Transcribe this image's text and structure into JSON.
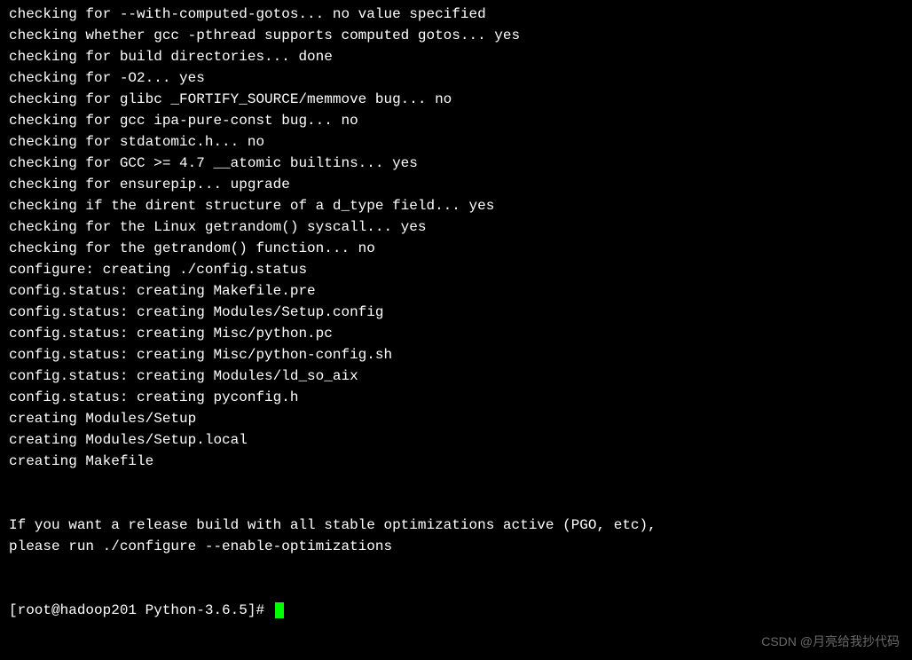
{
  "output_lines": [
    "checking for --with-computed-gotos... no value specified",
    "checking whether gcc -pthread supports computed gotos... yes",
    "checking for build directories... done",
    "checking for -O2... yes",
    "checking for glibc _FORTIFY_SOURCE/memmove bug... no",
    "checking for gcc ipa-pure-const bug... no",
    "checking for stdatomic.h... no",
    "checking for GCC >= 4.7 __atomic builtins... yes",
    "checking for ensurepip... upgrade",
    "checking if the dirent structure of a d_type field... yes",
    "checking for the Linux getrandom() syscall... yes",
    "checking for the getrandom() function... no",
    "configure: creating ./config.status",
    "config.status: creating Makefile.pre",
    "config.status: creating Modules/Setup.config",
    "config.status: creating Misc/python.pc",
    "config.status: creating Misc/python-config.sh",
    "config.status: creating Modules/ld_so_aix",
    "config.status: creating pyconfig.h",
    "creating Modules/Setup",
    "creating Modules/Setup.local",
    "creating Makefile",
    "",
    "",
    "If you want a release build with all stable optimizations active (PGO, etc),",
    "please run ./configure --enable-optimizations",
    "",
    ""
  ],
  "prompt": "[root@hadoop201 Python-3.6.5]# ",
  "watermark": "CSDN @月亮给我抄代码"
}
